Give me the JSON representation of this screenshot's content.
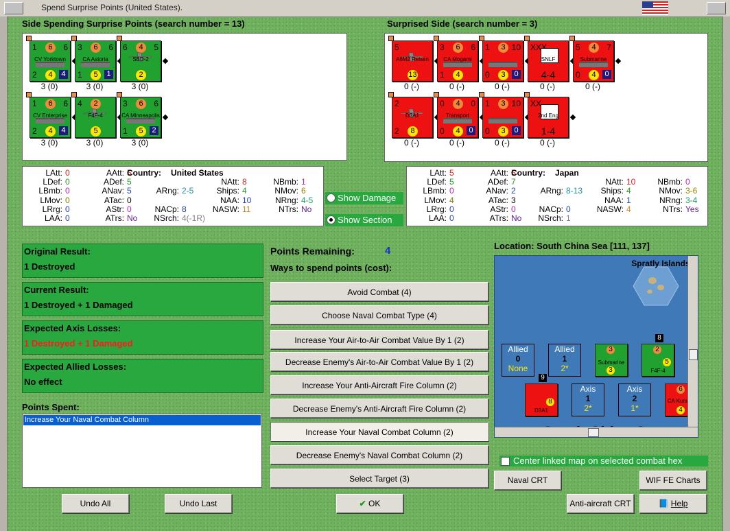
{
  "window": {
    "title": "Spend Surprise Points (United States)."
  },
  "left_panel": {
    "header": "Side Spending Surprise Points (search number = 13)",
    "units": [
      {
        "name": "CV Yorktown",
        "tl": "1",
        "tc": "6",
        "tr": "6",
        "bl": "2",
        "bc": "4",
        "br": "4",
        "caption": "3 (0)"
      },
      {
        "name": "CA Astoria",
        "tl": "3",
        "tc": "6",
        "tr": "6",
        "bl": "1",
        "bc": "5",
        "br": "1",
        "caption": "3 (0)"
      },
      {
        "name": "SBD-2",
        "tl": "6",
        "tc": "4",
        "tr": "5",
        "bl": "",
        "bc": "2",
        "br": "",
        "caption": "3 (0)"
      },
      {
        "name": "CV Enterprise",
        "tl": "1",
        "tc": "6",
        "tr": "6",
        "bl": "2",
        "bc": "4",
        "br": "4",
        "caption": "3 (0)"
      },
      {
        "name": "F4F-4",
        "tl": "4",
        "tc": "2",
        "tr": "",
        "bl": "",
        "bc": "5",
        "br": "",
        "caption": "3 (0)"
      },
      {
        "name": "CA Minneapolis",
        "tl": "3",
        "tc": "6",
        "tr": "6",
        "bl": "1",
        "bc": "5",
        "br": "2",
        "caption": "3 (0)"
      }
    ]
  },
  "right_panel": {
    "header": "Surprised Side (search number = 3)",
    "units": [
      {
        "name": "A6M2 Reisen",
        "tl": "5",
        "tc": "",
        "tr": "",
        "bl": "",
        "bc": "13",
        "br": "",
        "caption": "0 (-)"
      },
      {
        "name": "CA Mogami",
        "tl": "3",
        "tc": "6",
        "tr": "6",
        "bl": "1",
        "bc": "4",
        "br": "",
        "caption": "0 (-)"
      },
      {
        "name": "",
        "tl": "1",
        "tc": "3",
        "tr": "10",
        "bl": "0",
        "bc": "3",
        "br": "0",
        "caption": "0 (-)"
      },
      {
        "name": "SNLF",
        "tl": "XXX",
        "tc": "",
        "tr": "",
        "bl": "",
        "bc": "4-4",
        "br": "",
        "caption": "0 (-)"
      },
      {
        "name": "Submarine",
        "tl": "5",
        "tc": "4",
        "tr": "7",
        "bl": "0",
        "bc": "4",
        "br": "0",
        "caption": "0 (-)"
      },
      {
        "name": "D3A1",
        "tl": "2",
        "tc": "",
        "tr": "",
        "bl": "2",
        "bc": "8",
        "br": "",
        "caption": "0 (-)"
      },
      {
        "name": "Transport",
        "tl": "0",
        "tc": "4",
        "tr": "0",
        "bl": "0",
        "bc": "4",
        "br": "0",
        "caption": "0 (-)"
      },
      {
        "name": "",
        "tl": "1",
        "tc": "3",
        "tr": "10",
        "bl": "0",
        "bc": "3",
        "br": "0",
        "caption": "0 (-)"
      },
      {
        "name": "2nd Eng",
        "tl": "XX",
        "tc": "",
        "tr": "",
        "bl": "",
        "bc": "1-4",
        "br": "",
        "caption": "0 (-)"
      }
    ]
  },
  "stats_left": {
    "country_label": "Country:",
    "country": "United States",
    "LAtt": "0",
    "LDef": "0",
    "LBmb": "0",
    "LMov": "0",
    "LRrg": "0",
    "LAA": "0",
    "AAtt": "5",
    "ADef": "5",
    "ANav": "5",
    "ATac": "0",
    "AStr": "0",
    "ATrs": "No",
    "ARng": "2-5",
    "NACp": "8",
    "NSrch": "4(-1R)",
    "NAtt": "8",
    "Ships": "4",
    "NAA": "10",
    "NASW": "11",
    "NBmb": "1",
    "NMov": "6",
    "NRng": "4-5",
    "NTrs": "No"
  },
  "stats_right": {
    "country_label": "Country:",
    "country": "Japan",
    "LAtt": "5",
    "LDef": "5",
    "LBmb": "0",
    "LMov": "4",
    "LRrg": "0",
    "LAA": "0",
    "AAtt": "5",
    "ADef": "7",
    "ANav": "2",
    "ATac": "3",
    "AStr": "0",
    "ATrs": "No",
    "ARng": "8-13",
    "NACp": "0",
    "NSrch": "1",
    "NAtt": "10",
    "Ships": "4",
    "NAA": "1",
    "NASW": "4",
    "NBmb": "0",
    "NMov": "3-6",
    "NRng": "3-4",
    "NTrs": "Yes"
  },
  "toggles": {
    "show_damage": "Show Damage",
    "show_section": "Show Section"
  },
  "results": {
    "original_title": "Original Result:",
    "original": "1 Destroyed",
    "current_title": "Current Result:",
    "current": "1 Destroyed + 1 Damaged",
    "axis_title": "Expected Axis Losses:",
    "axis": "1 Destroyed + 1 Damaged",
    "allied_title": "Expected Allied Losses:",
    "allied": "No effect"
  },
  "points": {
    "spent_title": "Points Spent:",
    "spent_items": [
      "Increase Your Naval Combat Column"
    ],
    "remaining_label": "Points Remaining:",
    "remaining": "4",
    "ways_label": "Ways to spend points (cost):",
    "options": [
      "Avoid Combat (4)",
      "Choose Naval Combat Type (4)",
      "Increase Your Air-to-Air Combat Value By 1 (2)",
      "Decrease Enemy's Air-to-Air Combat Value By 1 (2)",
      "Increase Your Anti-Aircraft Fire Column (2)",
      "Decrease Enemy's Anti-Aircraft Fire Column (2)",
      "Increase Your Naval Combat Column (2)",
      "Decrease Enemy's Naval Combat Column (2)",
      "Select Target (3)"
    ]
  },
  "map": {
    "location": "Location: South China Sea [111, 137]",
    "island": "Spratly Islands (",
    "sea_label": "South China Se",
    "allied0_title": "Allied",
    "allied0_num": "0",
    "allied0_sub": "None",
    "allied1_title": "Allied",
    "allied1_num": "1",
    "allied1_sub": "2*",
    "axis1_title": "Axis",
    "axis1_num": "1",
    "axis1_sub": "2*",
    "axis2_title": "Axis",
    "axis2_num": "2",
    "axis2_sub": "1*",
    "stack_a": "8",
    "stack_b": "9",
    "sub_name": "Submarine",
    "f4f_name": "F4F-4",
    "d3a_name": "D3A1",
    "kunugi_name": "CA Kunugo",
    "center_label": "Center linked map on selected combat hex"
  },
  "buttons": {
    "undo_all": "Undo All",
    "undo_last": "Undo Last",
    "ok": "OK",
    "naval_crt": "Naval CRT",
    "wif_charts": "WIF FE Charts",
    "aa_crt": "Anti-aircraft CRT",
    "help": "Help"
  },
  "colors": {
    "green_counter": "#21a230",
    "red_counter": "#ee1111",
    "panel_green": "#29a840"
  }
}
